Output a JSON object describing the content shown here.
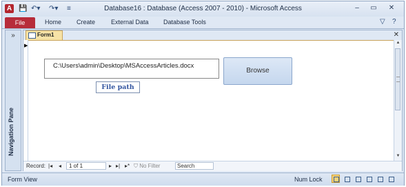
{
  "window": {
    "title": "Database16 : Database (Access 2007 - 2010)  -  Microsoft Access",
    "app_icon": "A",
    "qat": [
      "save-icon",
      "undo-icon",
      "redo-icon",
      "customize-icon"
    ]
  },
  "ribbon": {
    "tabs": [
      "File",
      "Home",
      "Create",
      "External Data",
      "Database Tools"
    ]
  },
  "nav_pane": {
    "label": "Navigation Pane",
    "toggle": "»"
  },
  "document": {
    "tab_label": "Form1",
    "path_value": "C:\\Users\\admin\\Desktop\\MSAccessArticles.docx",
    "browse_label": "Browse",
    "file_path_label": "File path"
  },
  "record_nav": {
    "label": "Record:",
    "first": "|◂",
    "prev": "◂",
    "position": "1 of 1",
    "next": "▸",
    "last": "▸|",
    "new": "▸*",
    "filter": "No Filter",
    "search": "Search"
  },
  "status": {
    "left": "Form View",
    "num_lock": "Num Lock"
  },
  "colors": {
    "file_tab": "#b72c3a",
    "form_tab": "#f6e2a6",
    "accent": "#3456a0"
  }
}
